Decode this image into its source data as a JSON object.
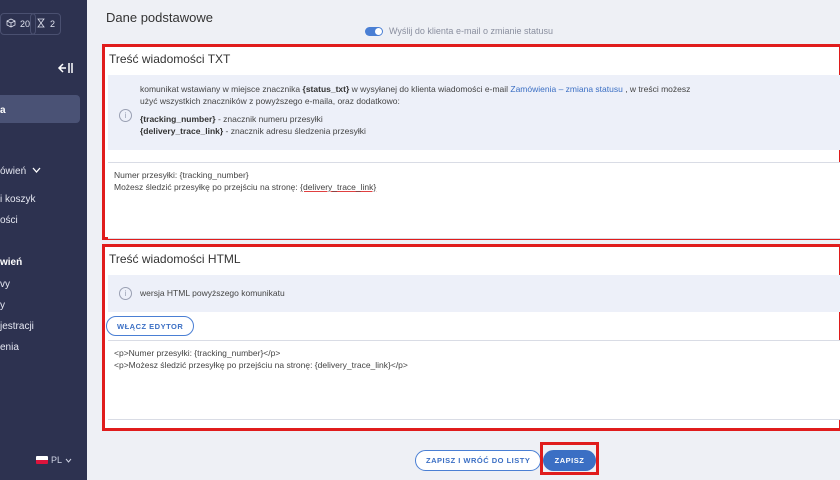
{
  "sidebar": {
    "badges": [
      {
        "icon": "cube-icon",
        "count": "20"
      },
      {
        "icon": "hourglass-icon",
        "count": "2"
      }
    ],
    "active_item": "a",
    "group_orders": "ówień",
    "items": [
      "i koszyk",
      "ości"
    ],
    "group2": "wień",
    "items2": [
      "vy",
      "y",
      "jestracji",
      "enia"
    ],
    "language": "PL",
    "colors": {
      "bg": "#2d3250",
      "active": "#4a5275"
    }
  },
  "main": {
    "title": "Dane podstawowe",
    "faded_row": "Wyślij do klienta e-mail o zmianie statusu",
    "txt_panel": {
      "title": "Treść wiadomości TXT",
      "info": {
        "line1_pre": "komunikat wstawiany w miejsce znacznika ",
        "line1_tag": "{status_txt}",
        "line1_mid": " w wysyłanej do klienta wiadomości e-mail ",
        "line1_link": "Zamówienia – zmiana statusu",
        "line1_post": " , w treści możesz",
        "line2": "użyć wszystkich znaczników z powyższego e-maila, oraz dodatkowo:",
        "tag1": "{tracking_number}",
        "tag1_desc": " - znacznik numeru przesyłki",
        "tag2": "{delivery_trace_link}",
        "tag2_desc": " - znacznik adresu śledzenia przesyłki"
      },
      "content": {
        "line1": "Numer przesyłki: {tracking_number}",
        "line2_pre": "Możesz śledzić przesyłkę po przejściu na stronę: ",
        "line2_tag": "{delivery_trace_link}"
      }
    },
    "html_panel": {
      "title": "Treść wiadomości HTML",
      "info": "wersja HTML powyższego komunikatu",
      "editor_button": "WŁĄCZ EDYTOR",
      "content": {
        "line1": "<p>Numer przesyłki: {tracking_number}</p>",
        "line2": "<p>Możesz śledzić przesyłkę po przejściu na stronę: {delivery_trace_link}</p>"
      }
    },
    "buttons": {
      "save_back": "ZAPISZ I WRÓĆ DO LISTY",
      "save": "ZAPISZ"
    },
    "colors": {
      "accent": "#3b6fc4",
      "highlight": "#e01c1c"
    }
  }
}
